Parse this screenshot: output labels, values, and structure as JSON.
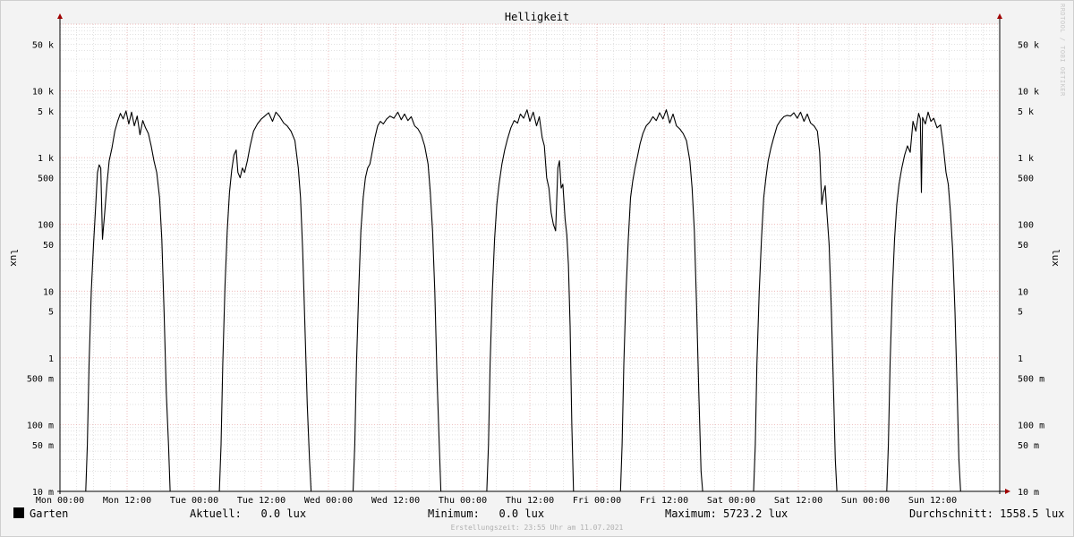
{
  "chart_data": {
    "type": "line",
    "title": "Helligkeit",
    "ylabel": "lux",
    "yscale": "log",
    "ylim": [
      0.01,
      100000
    ],
    "grid": true,
    "y_ticks": [
      {
        "value": 50000,
        "label": "50 k"
      },
      {
        "value": 10000,
        "label": "10 k"
      },
      {
        "value": 5000,
        "label": "5 k"
      },
      {
        "value": 1000,
        "label": "1 k"
      },
      {
        "value": 500,
        "label": "500"
      },
      {
        "value": 100,
        "label": "100"
      },
      {
        "value": 50,
        "label": "50"
      },
      {
        "value": 10,
        "label": "10"
      },
      {
        "value": 5,
        "label": "5"
      },
      {
        "value": 1,
        "label": "1"
      },
      {
        "value": 0.5,
        "label": "500 m"
      },
      {
        "value": 0.1,
        "label": "100 m"
      },
      {
        "value": 0.05,
        "label": "50 m"
      },
      {
        "value": 0.01,
        "label": "10 m"
      }
    ],
    "x_tick_labels": [
      "Mon 00:00",
      "Mon 12:00",
      "Tue 00:00",
      "Tue 12:00",
      "Wed 00:00",
      "Wed 12:00",
      "Thu 00:00",
      "Thu 12:00",
      "Fri 00:00",
      "Fri 12:00",
      "Sat 00:00",
      "Sat 12:00",
      "Sun 00:00",
      "Sun 12:00"
    ],
    "x_unit": "hours since Mon 00:00",
    "xlim": [
      0,
      168
    ],
    "series": [
      {
        "name": "Garten",
        "color": "#000000",
        "points": [
          [
            0,
            0.01
          ],
          [
            4.6,
            0.01
          ],
          [
            4.9,
            0.05
          ],
          [
            5.2,
            0.8
          ],
          [
            5.6,
            10
          ],
          [
            6.0,
            50
          ],
          [
            6.4,
            200
          ],
          [
            6.7,
            600
          ],
          [
            7.0,
            780
          ],
          [
            7.3,
            700
          ],
          [
            7.6,
            60
          ],
          [
            8.0,
            150
          ],
          [
            8.4,
            400
          ],
          [
            8.8,
            900
          ],
          [
            9.3,
            1400
          ],
          [
            9.8,
            2500
          ],
          [
            10.3,
            3500
          ],
          [
            10.8,
            4600
          ],
          [
            11.3,
            3800
          ],
          [
            11.8,
            5000
          ],
          [
            12.3,
            3200
          ],
          [
            12.8,
            4800
          ],
          [
            13.3,
            3000
          ],
          [
            13.8,
            4200
          ],
          [
            14.3,
            2200
          ],
          [
            14.8,
            3600
          ],
          [
            15.3,
            2800
          ],
          [
            15.8,
            2300
          ],
          [
            16.3,
            1500
          ],
          [
            16.8,
            900
          ],
          [
            17.3,
            600
          ],
          [
            17.8,
            250
          ],
          [
            18.2,
            60
          ],
          [
            18.6,
            5
          ],
          [
            19.0,
            0.3
          ],
          [
            19.4,
            0.05
          ],
          [
            19.7,
            0.01
          ],
          [
            24,
            0.01
          ],
          [
            28.5,
            0.01
          ],
          [
            28.8,
            0.05
          ],
          [
            29.1,
            0.8
          ],
          [
            29.5,
            12
          ],
          [
            29.9,
            80
          ],
          [
            30.3,
            300
          ],
          [
            30.7,
            650
          ],
          [
            31.1,
            1100
          ],
          [
            31.5,
            1300
          ],
          [
            31.8,
            600
          ],
          [
            32.2,
            500
          ],
          [
            32.6,
            700
          ],
          [
            33.0,
            600
          ],
          [
            33.5,
            900
          ],
          [
            34.0,
            1500
          ],
          [
            34.6,
            2500
          ],
          [
            35.3,
            3200
          ],
          [
            36.0,
            3800
          ],
          [
            36.6,
            4200
          ],
          [
            37.3,
            4700
          ],
          [
            38.0,
            3500
          ],
          [
            38.6,
            4800
          ],
          [
            39.3,
            4100
          ],
          [
            40.0,
            3300
          ],
          [
            40.6,
            3000
          ],
          [
            41.3,
            2500
          ],
          [
            42.0,
            1800
          ],
          [
            42.6,
            700
          ],
          [
            43.0,
            250
          ],
          [
            43.4,
            40
          ],
          [
            43.8,
            3
          ],
          [
            44.2,
            0.2
          ],
          [
            44.6,
            0.03
          ],
          [
            44.9,
            0.01
          ],
          [
            48,
            0.01
          ],
          [
            52.4,
            0.01
          ],
          [
            52.7,
            0.05
          ],
          [
            53.0,
            0.8
          ],
          [
            53.4,
            10
          ],
          [
            53.8,
            80
          ],
          [
            54.2,
            250
          ],
          [
            54.6,
            500
          ],
          [
            55.0,
            700
          ],
          [
            55.4,
            800
          ],
          [
            55.8,
            1200
          ],
          [
            56.3,
            2000
          ],
          [
            56.8,
            3000
          ],
          [
            57.3,
            3500
          ],
          [
            57.8,
            3200
          ],
          [
            58.4,
            3800
          ],
          [
            59.0,
            4200
          ],
          [
            59.7,
            3900
          ],
          [
            60.4,
            4800
          ],
          [
            61.0,
            3700
          ],
          [
            61.6,
            4500
          ],
          [
            62.2,
            3600
          ],
          [
            62.8,
            4100
          ],
          [
            63.4,
            3000
          ],
          [
            64.0,
            2700
          ],
          [
            64.6,
            2200
          ],
          [
            65.2,
            1500
          ],
          [
            65.8,
            800
          ],
          [
            66.2,
            300
          ],
          [
            66.6,
            80
          ],
          [
            67.0,
            10
          ],
          [
            67.4,
            0.5
          ],
          [
            67.8,
            0.05
          ],
          [
            68.1,
            0.01
          ],
          [
            72,
            0.01
          ],
          [
            76.3,
            0.01
          ],
          [
            76.6,
            0.05
          ],
          [
            76.9,
            0.8
          ],
          [
            77.3,
            10
          ],
          [
            77.7,
            60
          ],
          [
            78.1,
            200
          ],
          [
            78.5,
            400
          ],
          [
            79.0,
            800
          ],
          [
            79.5,
            1300
          ],
          [
            80.0,
            1900
          ],
          [
            80.6,
            2800
          ],
          [
            81.2,
            3600
          ],
          [
            81.8,
            3300
          ],
          [
            82.3,
            4500
          ],
          [
            82.9,
            3900
          ],
          [
            83.5,
            5200
          ],
          [
            84.0,
            3500
          ],
          [
            84.6,
            4800
          ],
          [
            85.2,
            3000
          ],
          [
            85.7,
            4100
          ],
          [
            86.2,
            2000
          ],
          [
            86.6,
            1500
          ],
          [
            87.0,
            500
          ],
          [
            87.4,
            350
          ],
          [
            87.8,
            150
          ],
          [
            88.2,
            100
          ],
          [
            88.6,
            80
          ],
          [
            89.0,
            700
          ],
          [
            89.3,
            900
          ],
          [
            89.6,
            350
          ],
          [
            89.9,
            400
          ],
          [
            90.3,
            120
          ],
          [
            90.6,
            70
          ],
          [
            90.9,
            25
          ],
          [
            91.2,
            3
          ],
          [
            91.5,
            0.1
          ],
          [
            91.8,
            0.01
          ],
          [
            96,
            0.01
          ],
          [
            100.2,
            0.01
          ],
          [
            100.5,
            0.05
          ],
          [
            100.8,
            0.8
          ],
          [
            101.2,
            10
          ],
          [
            101.6,
            60
          ],
          [
            102.0,
            250
          ],
          [
            102.4,
            450
          ],
          [
            102.8,
            700
          ],
          [
            103.2,
            1000
          ],
          [
            103.7,
            1600
          ],
          [
            104.2,
            2300
          ],
          [
            104.8,
            3000
          ],
          [
            105.4,
            3400
          ],
          [
            106.0,
            4100
          ],
          [
            106.6,
            3600
          ],
          [
            107.2,
            4700
          ],
          [
            107.8,
            3800
          ],
          [
            108.4,
            5200
          ],
          [
            109.0,
            3300
          ],
          [
            109.6,
            4500
          ],
          [
            110.2,
            3000
          ],
          [
            110.8,
            2700
          ],
          [
            111.4,
            2300
          ],
          [
            112.0,
            1800
          ],
          [
            112.6,
            900
          ],
          [
            113.0,
            350
          ],
          [
            113.4,
            80
          ],
          [
            113.8,
            6
          ],
          [
            114.2,
            0.3
          ],
          [
            114.6,
            0.02
          ],
          [
            114.9,
            0.01
          ],
          [
            120,
            0.01
          ],
          [
            124.0,
            0.01
          ],
          [
            124.3,
            0.05
          ],
          [
            124.6,
            0.8
          ],
          [
            125.0,
            10
          ],
          [
            125.4,
            60
          ],
          [
            125.8,
            250
          ],
          [
            126.2,
            500
          ],
          [
            126.6,
            900
          ],
          [
            127.1,
            1400
          ],
          [
            127.6,
            2000
          ],
          [
            128.2,
            3000
          ],
          [
            128.8,
            3600
          ],
          [
            129.4,
            4100
          ],
          [
            130.0,
            4300
          ],
          [
            130.6,
            4200
          ],
          [
            131.2,
            4700
          ],
          [
            131.8,
            3900
          ],
          [
            132.4,
            4800
          ],
          [
            133.0,
            3500
          ],
          [
            133.6,
            4500
          ],
          [
            134.2,
            3300
          ],
          [
            134.8,
            3000
          ],
          [
            135.4,
            2500
          ],
          [
            135.8,
            1200
          ],
          [
            136.2,
            200
          ],
          [
            136.5,
            300
          ],
          [
            136.8,
            380
          ],
          [
            137.1,
            150
          ],
          [
            137.5,
            50
          ],
          [
            137.9,
            5
          ],
          [
            138.3,
            0.3
          ],
          [
            138.6,
            0.03
          ],
          [
            138.9,
            0.01
          ],
          [
            144,
            0.01
          ],
          [
            147.8,
            0.01
          ],
          [
            148.1,
            0.05
          ],
          [
            148.4,
            0.8
          ],
          [
            148.8,
            10
          ],
          [
            149.2,
            60
          ],
          [
            149.6,
            200
          ],
          [
            150.0,
            400
          ],
          [
            150.5,
            700
          ],
          [
            151.0,
            1100
          ],
          [
            151.5,
            1500
          ],
          [
            152.0,
            1200
          ],
          [
            152.5,
            3500
          ],
          [
            153.0,
            2500
          ],
          [
            153.5,
            4600
          ],
          [
            153.8,
            3800
          ],
          [
            154.0,
            300
          ],
          [
            154.2,
            4000
          ],
          [
            154.7,
            3200
          ],
          [
            155.2,
            4800
          ],
          [
            155.7,
            3500
          ],
          [
            156.2,
            3900
          ],
          [
            156.8,
            2800
          ],
          [
            157.4,
            3100
          ],
          [
            157.9,
            1500
          ],
          [
            158.4,
            600
          ],
          [
            158.8,
            400
          ],
          [
            159.2,
            150
          ],
          [
            159.6,
            40
          ],
          [
            160.0,
            5
          ],
          [
            160.4,
            0.3
          ],
          [
            160.7,
            0.03
          ],
          [
            161.0,
            0.01
          ],
          [
            168,
            0.01
          ]
        ]
      }
    ]
  },
  "legend": {
    "series_name": "Garten",
    "current_label": "Aktuell:",
    "current_value": "0.0 lux",
    "min_label": "Minimum:",
    "min_value": "0.0 lux",
    "max_label": "Maximum:",
    "max_value": "5723.2 lux",
    "avg_label": "Durchschnitt:",
    "avg_value": "1558.5 lux"
  },
  "footer": "Erstellungszeit: 23:55 Uhr am 11.07.2021",
  "watermark": "RRDTOOL / TOBI OETIKER",
  "colors": {
    "background": "#f3f3f3",
    "plot": "#ffffff",
    "major_grid": "#e6a0a0",
    "minor_grid": "#cfcfcf",
    "line": "#000000",
    "arrow": "#a00000"
  }
}
